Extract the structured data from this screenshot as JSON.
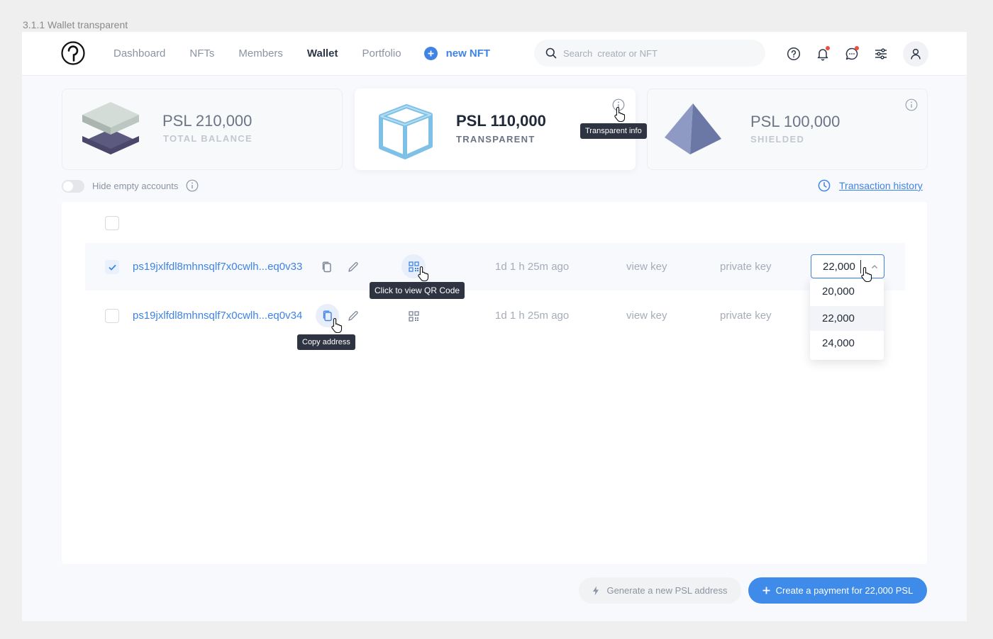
{
  "frame_label": "3.1.1 Wallet transparent",
  "header": {
    "nav": [
      {
        "label": "Dashboard",
        "active": false
      },
      {
        "label": "NFTs",
        "active": false
      },
      {
        "label": "Members",
        "active": false
      },
      {
        "label": "Wallet",
        "active": true
      },
      {
        "label": "Portfolio",
        "active": false
      }
    ],
    "new_nft_label": "new NFT",
    "search_placeholder": "Search  creator or NFT",
    "icons": [
      "help-icon",
      "bell-icon",
      "chat-icon",
      "sliders-icon",
      "user-icon"
    ]
  },
  "cards": [
    {
      "amount": "PSL 210,000",
      "caption": "TOTAL BALANCE",
      "active": false
    },
    {
      "amount": "PSL 110,000",
      "caption": "TRANSPARENT",
      "active": true
    },
    {
      "amount": "PSL 100,000",
      "caption": "SHIELDED",
      "active": false
    }
  ],
  "tooltips": {
    "transparent_info": "Transparent info",
    "qr": "Click to view QR Code",
    "copy": "Copy address"
  },
  "hide_empty_label": "Hide empty accounts",
  "transaction_history_label": "Transaction history",
  "rows": [
    {
      "address": "ps19jxlfdl8mhnsqlf7x0cwlh...eq0v33",
      "time": "1d 1 h 25m ago",
      "view_key": "view key",
      "private_key": "private key",
      "amount": "22,000",
      "checked": true
    },
    {
      "address": "ps19jxlfdl8mhnsqlf7x0cwlh...eq0v34",
      "time": "1d 1 h 25m ago",
      "view_key": "view key",
      "private_key": "private key",
      "amount": "",
      "checked": false
    }
  ],
  "dropdown_options": [
    "20,000",
    "22,000",
    "24,000"
  ],
  "dropdown_selected": "22,000",
  "buttons": {
    "generate": "Generate a new PSL address",
    "create_payment": "Create a payment for 22,000 PSL"
  },
  "colors": {
    "accent": "#3f83e4",
    "notification": "#ef4f3f",
    "tooltip_bg": "#2e3442"
  }
}
